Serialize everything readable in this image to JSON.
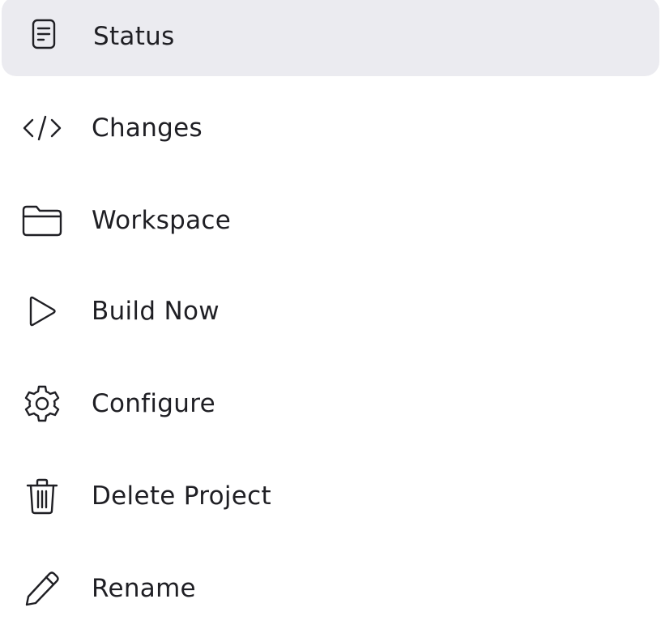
{
  "menu": {
    "items": [
      {
        "label": "Status",
        "icon": "document-icon",
        "active": true
      },
      {
        "label": "Changes",
        "icon": "code-icon"
      },
      {
        "label": "Workspace",
        "icon": "folder-icon"
      },
      {
        "label": "Build Now",
        "icon": "play-icon"
      },
      {
        "label": "Configure",
        "icon": "gear-icon"
      },
      {
        "label": "Delete Project",
        "icon": "trash-icon"
      },
      {
        "label": "Rename",
        "icon": "pencil-icon"
      }
    ]
  },
  "colors": {
    "active_background": "#ebebf0",
    "text": "#1f1f24",
    "background": "#ffffff"
  }
}
